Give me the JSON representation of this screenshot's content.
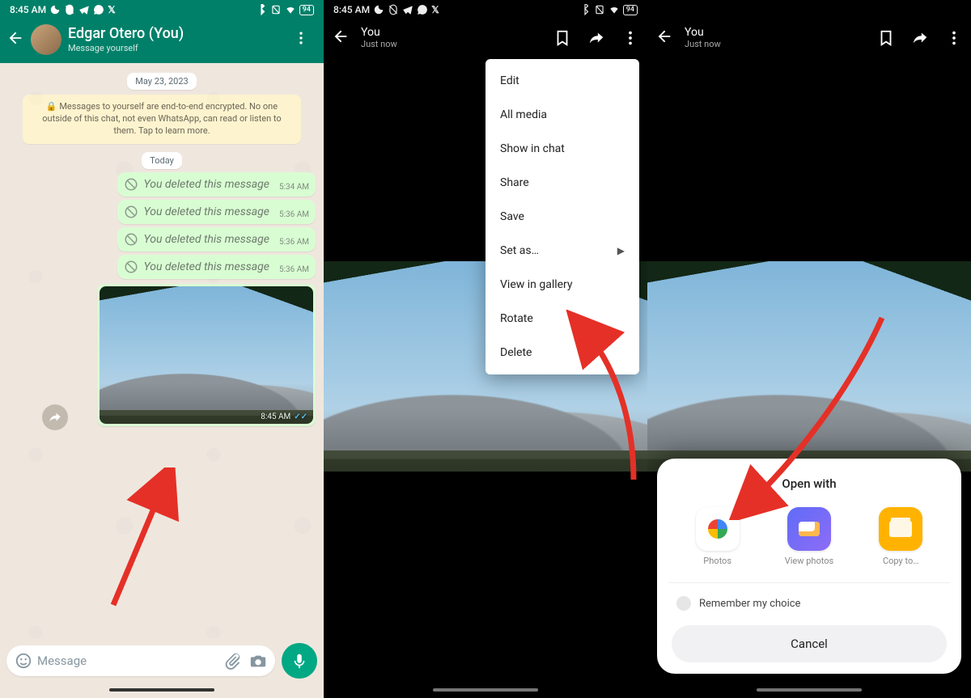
{
  "status": {
    "time": "8:45 AM",
    "battery": "94"
  },
  "p1": {
    "contact": "Edgar Otero (You)",
    "subtitle": "Message yourself",
    "date1": "May 23, 2023",
    "encryption": "🔒 Messages to yourself are end-to-end encrypted. No one outside of this chat, not even WhatsApp, can read or listen to them. Tap to learn more.",
    "date2": "Today",
    "deleted_text": "You deleted this message",
    "deleted": [
      {
        "time": "5:34 AM"
      },
      {
        "time": "5:36 AM"
      },
      {
        "time": "5:36 AM"
      },
      {
        "time": "5:36 AM"
      }
    ],
    "photo_time": "8:45 AM",
    "compose_placeholder": "Message"
  },
  "mv": {
    "title": "You",
    "subtitle": "Just now"
  },
  "menu": {
    "edit": "Edit",
    "all_media": "All media",
    "show_in_chat": "Show in chat",
    "share": "Share",
    "save": "Save",
    "set_as": "Set as…",
    "view_gallery": "View in gallery",
    "rotate": "Rotate",
    "delete": "Delete"
  },
  "sheet": {
    "title": "Open with",
    "apps": {
      "photos": "Photos",
      "view_photos": "View photos",
      "copy_to": "Copy to…"
    },
    "remember": "Remember my choice",
    "cancel": "Cancel"
  }
}
